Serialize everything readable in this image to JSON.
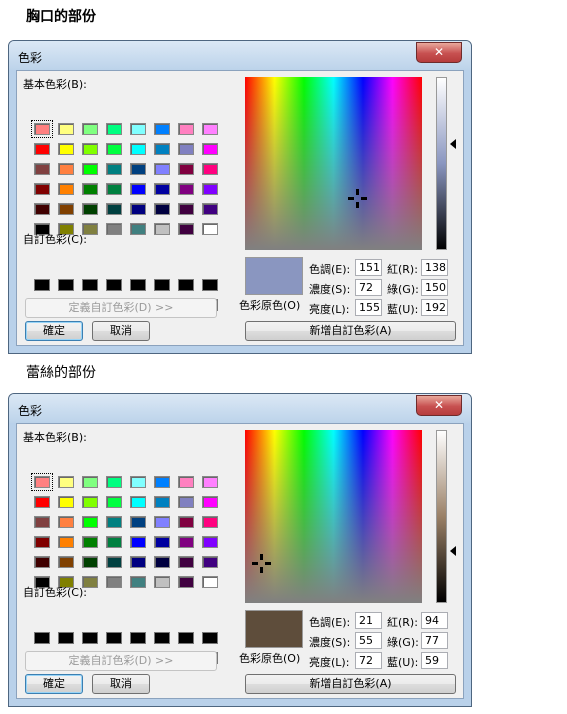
{
  "section1": {
    "heading": "胸口的部份"
  },
  "section2": {
    "heading": "蕾絲的部份"
  },
  "dialog": {
    "title": "色彩",
    "close_icon": "close-x-icon",
    "basic_colors_label": "基本色彩(B):",
    "custom_colors_label": "自訂色彩(C):",
    "define_custom_label": "定義自訂色彩(D) >>",
    "ok_label": "確定",
    "cancel_label": "取消",
    "solid_color_label": "色彩原色(O)",
    "hue_label": "色調(E):",
    "sat_label": "濃度(S):",
    "lum_label": "亮度(L):",
    "red_label": "紅(R):",
    "green_label": "綠(G):",
    "blue_label": "藍(U):",
    "add_custom_label": "新增自訂色彩(A)",
    "basic_colors": [
      "#ff8080",
      "#ffff80",
      "#80ff80",
      "#00ff80",
      "#80ffff",
      "#0080ff",
      "#ff80c0",
      "#ff80ff",
      "#ff0000",
      "#ffff00",
      "#80ff00",
      "#00ff40",
      "#00ffff",
      "#0080c0",
      "#8080c0",
      "#ff00ff",
      "#804040",
      "#ff8040",
      "#00ff00",
      "#008080",
      "#004080",
      "#8080ff",
      "#800040",
      "#ff0080",
      "#800000",
      "#ff8000",
      "#008000",
      "#008040",
      "#0000ff",
      "#0000a0",
      "#800080",
      "#8000ff",
      "#400000",
      "#804000",
      "#004000",
      "#004040",
      "#000080",
      "#000040",
      "#400040",
      "#400080",
      "#000000",
      "#808000",
      "#808040",
      "#808080",
      "#408080",
      "#c0c0c0",
      "#400040",
      "#ffffff"
    ],
    "custom_colors": [
      "#000000",
      "#000000",
      "#000000",
      "#000000",
      "#000000",
      "#000000",
      "#000000",
      "#000000",
      "#000000",
      "#000000",
      "#000000",
      "#000000",
      "#000000",
      "#000000",
      "#000000",
      "#000000"
    ]
  },
  "dialog1_values": {
    "hue": "151",
    "sat": "72",
    "lum": "155",
    "red": "138",
    "green": "150",
    "blue": "192",
    "preview_color": "#8a96c0",
    "lum_gradient_top": "#ffffff",
    "lum_gradient_mid": "#8a96c0",
    "lum_gradient_bottom": "#000000",
    "lum_level": 0.61,
    "crosshair_hue": 151,
    "crosshair_sat": 72
  },
  "dialog2_values": {
    "hue": "21",
    "sat": "55",
    "lum": "72",
    "red": "94",
    "green": "77",
    "blue": "59",
    "preview_color": "#5e4d3b",
    "lum_gradient_top": "#ffffff",
    "lum_gradient_mid": "#9a8066",
    "lum_gradient_bottom": "#000000",
    "lum_level": 0.3,
    "crosshair_hue": 21,
    "crosshair_sat": 55
  }
}
